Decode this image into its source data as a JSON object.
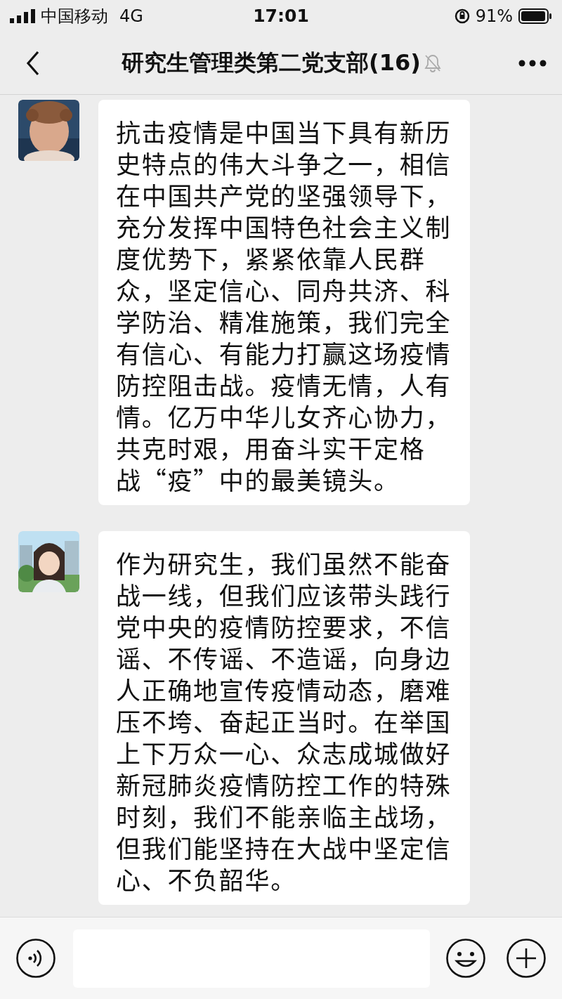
{
  "status_bar": {
    "carrier": "中国移动",
    "network": "4G",
    "time": "17:01",
    "battery_text": "91%"
  },
  "header": {
    "title": "研究生管理类第二党支部(16)",
    "muted": true
  },
  "messages": [
    {
      "text": "抗击疫情是中国当下具有新历史特点的伟大斗争之一，相信在中国共产党的坚强领导下，充分发挥中国特色社会主义制度优势下，紧紧依靠人民群众，坚定信心、同舟共济、科学防治、精准施策，我们完全有信心、有能力打赢这场疫情防控阻击战。疫情无情，人有情。亿万中华儿女齐心协力，共克时艰，用奋斗实干定格战“疫”中的最美镜头。"
    },
    {
      "text": "作为研究生，我们虽然不能奋战一线，但我们应该带头践行党中央的疫情防控要求，不信谣、不传谣、不造谣，向身边人正确地宣传疫情动态，磨难压不垮、奋起正当时。在举国上下万众一心、众志成城做好新冠肺炎疫情防控工作的特殊时刻，我们不能亲临主战场，但我们能坚持在大战中坚定信心、不负韶华。"
    }
  ]
}
